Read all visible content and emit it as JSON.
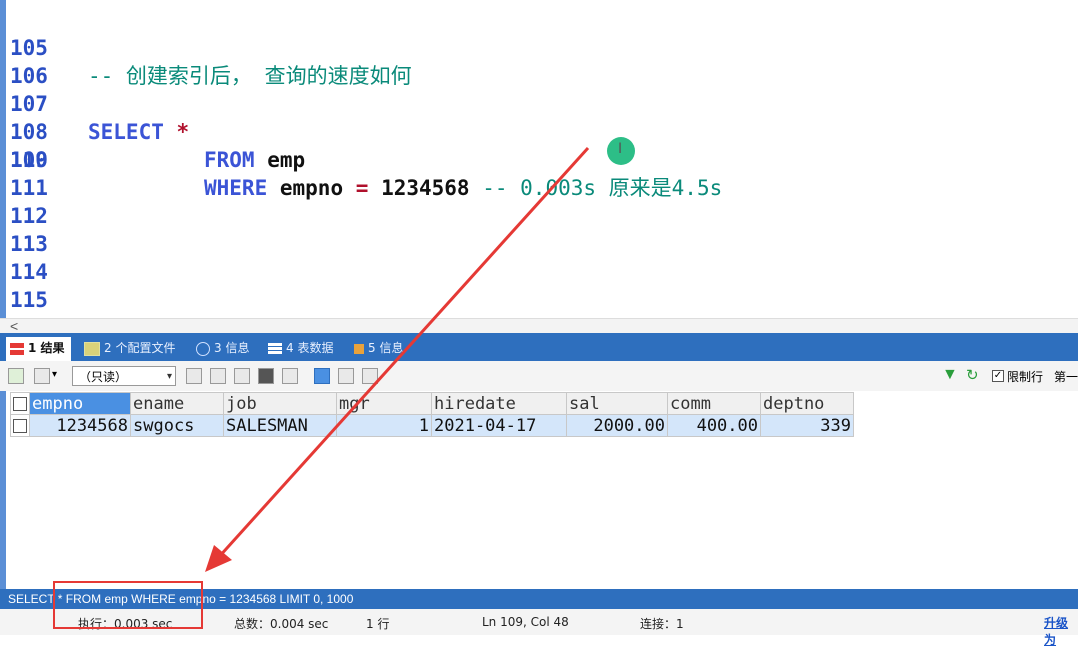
{
  "editor": {
    "lines": [
      {
        "n": "105",
        "comment": "-- 创建索引后， 查询的速度如何"
      },
      {
        "n": "106"
      },
      {
        "n": "107",
        "kw": "SELECT",
        "op": "*"
      },
      {
        "n": "108",
        "kw": "FROM",
        "id": "emp"
      },
      {
        "n": "109",
        "kw": "WHERE",
        "id": "empno",
        "op": "=",
        "num": "1234568",
        "comment": "-- 0.003s 原来是4.5s"
      },
      {
        "n": "110"
      },
      {
        "n": "111"
      },
      {
        "n": "112"
      },
      {
        "n": "113"
      },
      {
        "n": "114"
      },
      {
        "n": "115"
      }
    ],
    "cursor_glyph": "I",
    "scroll_left": "<"
  },
  "tabs": [
    {
      "label": "1 结果",
      "active": true
    },
    {
      "label": "2 个配置文件"
    },
    {
      "label": "3 信息"
    },
    {
      "label": "4 表数据"
    },
    {
      "label": "5 信息"
    }
  ],
  "toolbar": {
    "readonly_option": "（只读）",
    "limit_rows_label": "限制行",
    "first_label": "第一",
    "limit_checked": "✓"
  },
  "grid": {
    "columns": [
      "empno",
      "ename",
      "job",
      "mgr",
      "hiredate",
      "sal",
      "comm",
      "deptno"
    ],
    "rows": [
      [
        "1234568",
        "swgocs",
        "SALESMAN",
        "1",
        "2021-04-17",
        "2000.00",
        "400.00",
        "339"
      ]
    ]
  },
  "sql_status": "SELECT * FROM emp WHERE empno = 1234568 LIMIT 0, 1000",
  "status": {
    "exec": "执行：0.003 sec",
    "total": "总数：0.004 sec",
    "rows": "1 行",
    "position": "Ln 109, Col 48",
    "connections": "连接：1",
    "upgrade": "升级为"
  },
  "colors": {
    "accent": "#2e6fbe",
    "highlight": "#e53935",
    "cursor": "#17b77b"
  }
}
